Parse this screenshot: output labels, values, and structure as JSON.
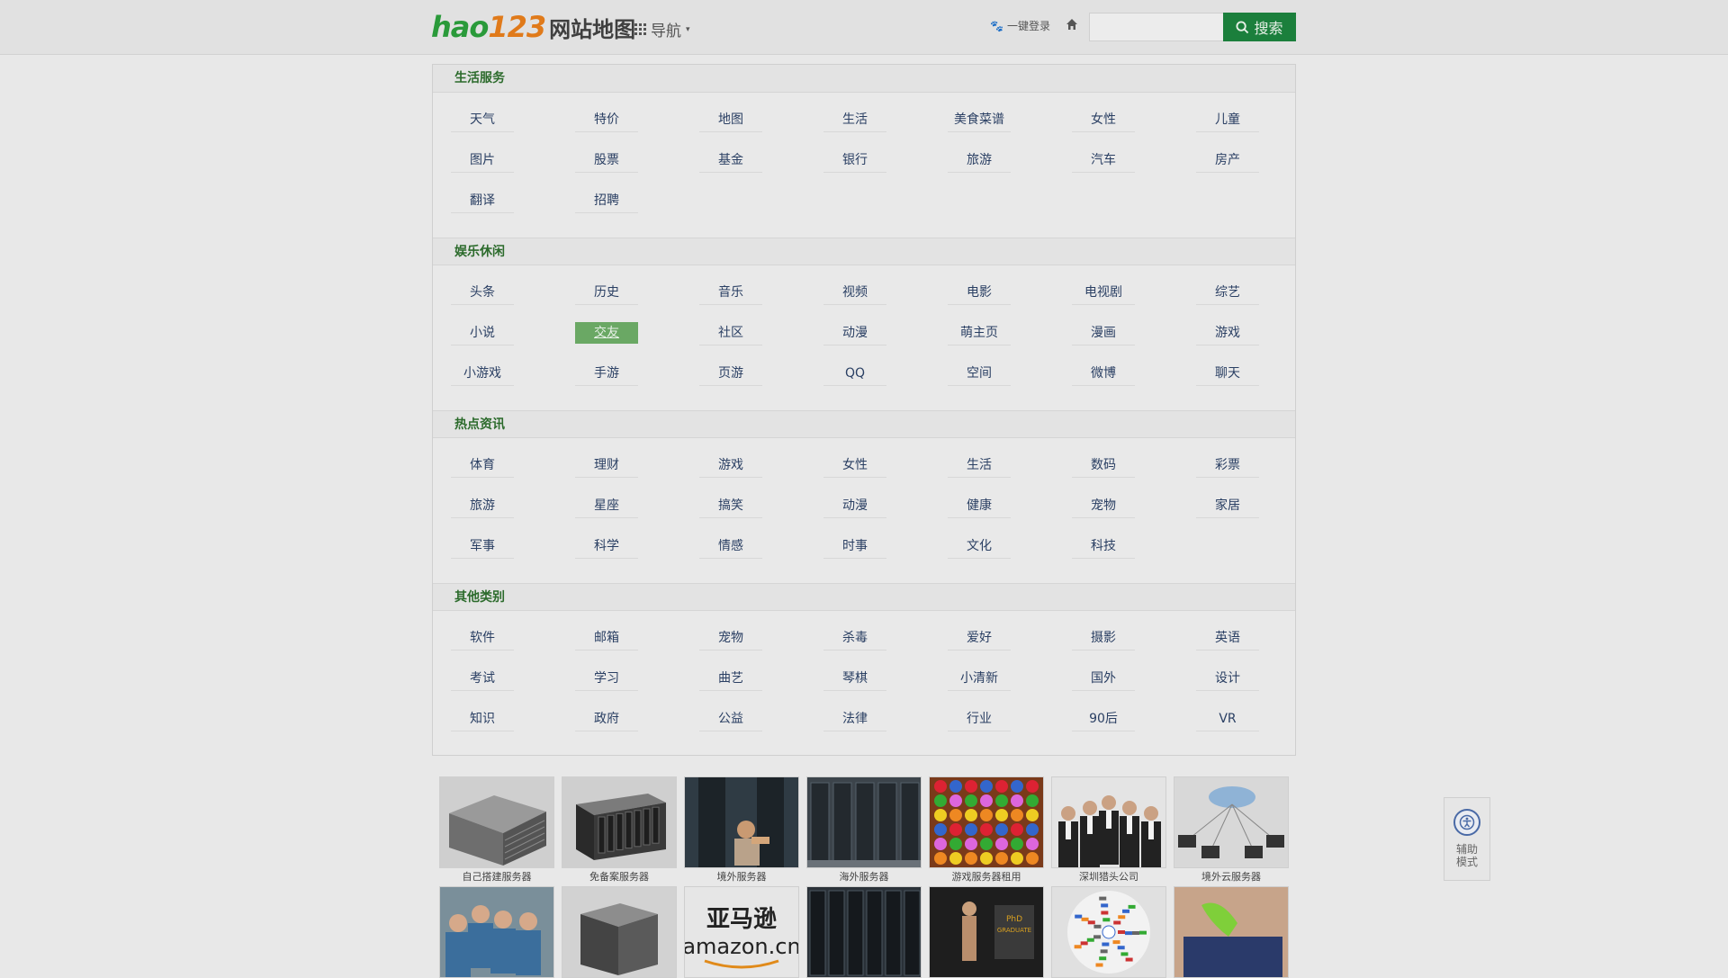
{
  "header": {
    "logo_hao": "hao",
    "logo_123": "123",
    "logo_sub": "网站地图",
    "nav_label": "导航",
    "login_label": "一键登录",
    "search_placeholder": "",
    "search_button": "搜索"
  },
  "sections": [
    {
      "title": "生活服务",
      "items": [
        "天气",
        "特价",
        "地图",
        "生活",
        "美食菜谱",
        "女性",
        "儿童",
        "图片",
        "股票",
        "基金",
        "银行",
        "旅游",
        "汽车",
        "房产",
        "翻译",
        "招聘"
      ]
    },
    {
      "title": "娱乐休闲",
      "items": [
        "头条",
        "历史",
        "音乐",
        "视频",
        "电影",
        "电视剧",
        "综艺",
        "小说",
        "交友",
        "社区",
        "动漫",
        "萌主页",
        "漫画",
        "游戏",
        "小游戏",
        "手游",
        "页游",
        "QQ",
        "空间",
        "微博",
        "聊天"
      ],
      "highlight": 8
    },
    {
      "title": "热点资讯",
      "items": [
        "体育",
        "理财",
        "游戏",
        "女性",
        "生活",
        "数码",
        "彩票",
        "旅游",
        "星座",
        "搞笑",
        "动漫",
        "健康",
        "宠物",
        "家居",
        "军事",
        "科学",
        "情感",
        "时事",
        "文化",
        "科技"
      ]
    },
    {
      "title": "其他类别",
      "items": [
        "软件",
        "邮箱",
        "宠物",
        "杀毒",
        "爱好",
        "摄影",
        "英语",
        "考试",
        "学习",
        "曲艺",
        "琴棋",
        "小清新",
        "国外",
        "设计",
        "知识",
        "政府",
        "公益",
        "法律",
        "行业",
        "90后",
        "VR"
      ]
    }
  ],
  "thumbs_row1": [
    {
      "caption": "自己搭建服务器",
      "icon": "server-box"
    },
    {
      "caption": "免备案服务器",
      "icon": "rack-server"
    },
    {
      "caption": "境外服务器",
      "icon": "technician"
    },
    {
      "caption": "海外服务器",
      "icon": "datacenter"
    },
    {
      "caption": "游戏服务器租用",
      "icon": "game-board"
    },
    {
      "caption": "深圳猎头公司",
      "icon": "business-team"
    },
    {
      "caption": "境外云服务器",
      "icon": "cloud-network"
    }
  ],
  "thumbs_row2": [
    {
      "caption": "",
      "icon": "students"
    },
    {
      "caption": "",
      "icon": "server-cube"
    },
    {
      "caption": "",
      "icon": "amazon-logo",
      "brand_cn": "亚马逊",
      "brand_en": "amazon.cn"
    },
    {
      "caption": "",
      "icon": "server-racks"
    },
    {
      "caption": "",
      "icon": "graduate",
      "badge_line1": "PhD",
      "badge_line2": "GRADUATE"
    },
    {
      "caption": "",
      "icon": "cloud-logos"
    },
    {
      "caption": "",
      "icon": "usb-cleaner"
    }
  ],
  "assist": {
    "label": "辅助模式"
  },
  "colors": {
    "accent": "#1b7f3c",
    "section_title": "#2c6b2c",
    "link": "#2a3f63",
    "highlight": "#6aa864"
  }
}
